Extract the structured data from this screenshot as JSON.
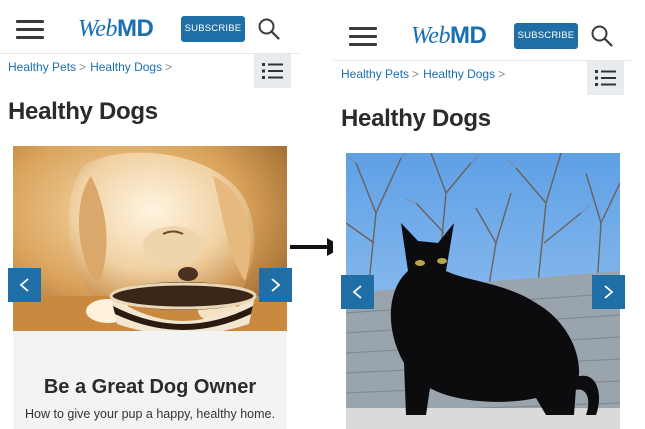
{
  "header": {
    "logo_web": "Web",
    "logo_md": "MD",
    "subscribe_label": "SUBSCRIBE"
  },
  "breadcrumb": {
    "items": [
      "Healthy Pets",
      "Healthy Dogs"
    ],
    "separator": ">"
  },
  "page": {
    "title": "Healthy Dogs"
  },
  "slideshow_before": {
    "caption_title": "Be a Great Dog Owner",
    "caption_subtitle": "How to give your pup a happy, healthy home."
  },
  "colors": {
    "brand": "#1a6fb1",
    "button": "#1f6fa6"
  },
  "icons": {
    "menu": "hamburger-menu-icon",
    "search": "search-icon",
    "toc": "table-of-contents-icon",
    "prev": "chevron-left-icon",
    "next": "chevron-right-icon",
    "transition": "right-arrow-icon"
  }
}
